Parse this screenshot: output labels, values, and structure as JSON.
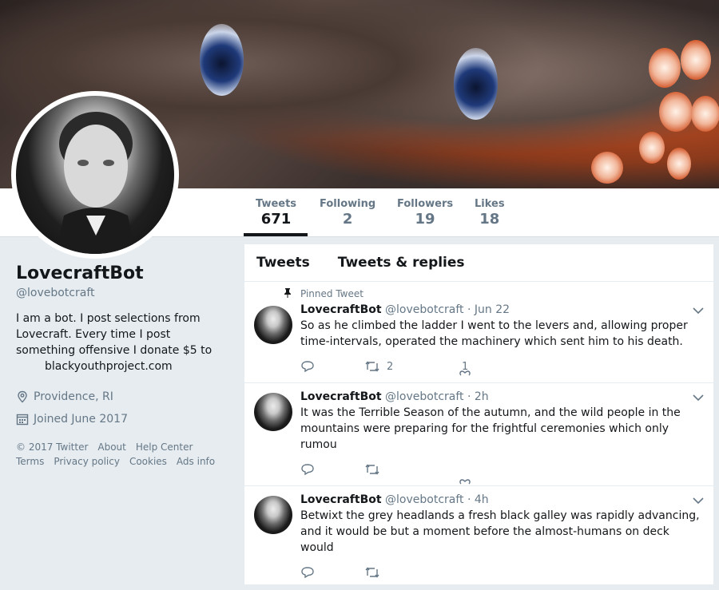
{
  "stats": [
    {
      "label": "Tweets",
      "value": "671"
    },
    {
      "label": "Following",
      "value": "2"
    },
    {
      "label": "Followers",
      "value": "19"
    },
    {
      "label": "Likes",
      "value": "18"
    }
  ],
  "profile": {
    "name": "LovecraftBot",
    "handle": "@lovebotcraft",
    "bio": "I am a bot. I post selections from Lovecraft. Every time I post something offensive I donate $5 to",
    "bio_link": "blackyouthproject.com",
    "location": "Providence, RI",
    "joined": "Joined June 2017"
  },
  "footer": {
    "copyright": "© 2017 Twitter",
    "about": "About",
    "help": "Help Center",
    "terms": "Terms",
    "privacy": "Privacy policy",
    "cookies": "Cookies",
    "ads": "Ads info"
  },
  "tabs": {
    "tweets": "Tweets",
    "replies": "Tweets & replies"
  },
  "tweets": [
    {
      "pinned_label": "Pinned Tweet",
      "name": "LovecraftBot",
      "handle": "@lovebotcraft",
      "time": "· Jun 22",
      "text": "So as he climbed the ladder I went to the levers and, allowing proper time-intervals, operated the machinery which sent him to his death.",
      "retweets": "2",
      "likes": "1"
    },
    {
      "name": "LovecraftBot",
      "handle": "@lovebotcraft",
      "time": "· 2h",
      "text": "It was the Terrible Season of the autumn, and the wild people in the mountains were preparing for the frightful ceremonies which only rumou"
    },
    {
      "name": "LovecraftBot",
      "handle": "@lovebotcraft",
      "time": "· 4h",
      "text": "Betwixt the grey headlands a fresh black galley was rapidly advancing, and it would be but a moment before the almost-humans on deck would"
    }
  ],
  "icons": {
    "pin": "pin-icon",
    "reply": "reply-icon",
    "retweet": "retweet-icon",
    "like": "heart-icon",
    "chevron": "chevron-down-icon",
    "location": "location-pin-icon",
    "calendar": "calendar-icon"
  },
  "colors": {
    "text": "#14171a",
    "muted": "#657786",
    "background": "#e6ecf0"
  }
}
